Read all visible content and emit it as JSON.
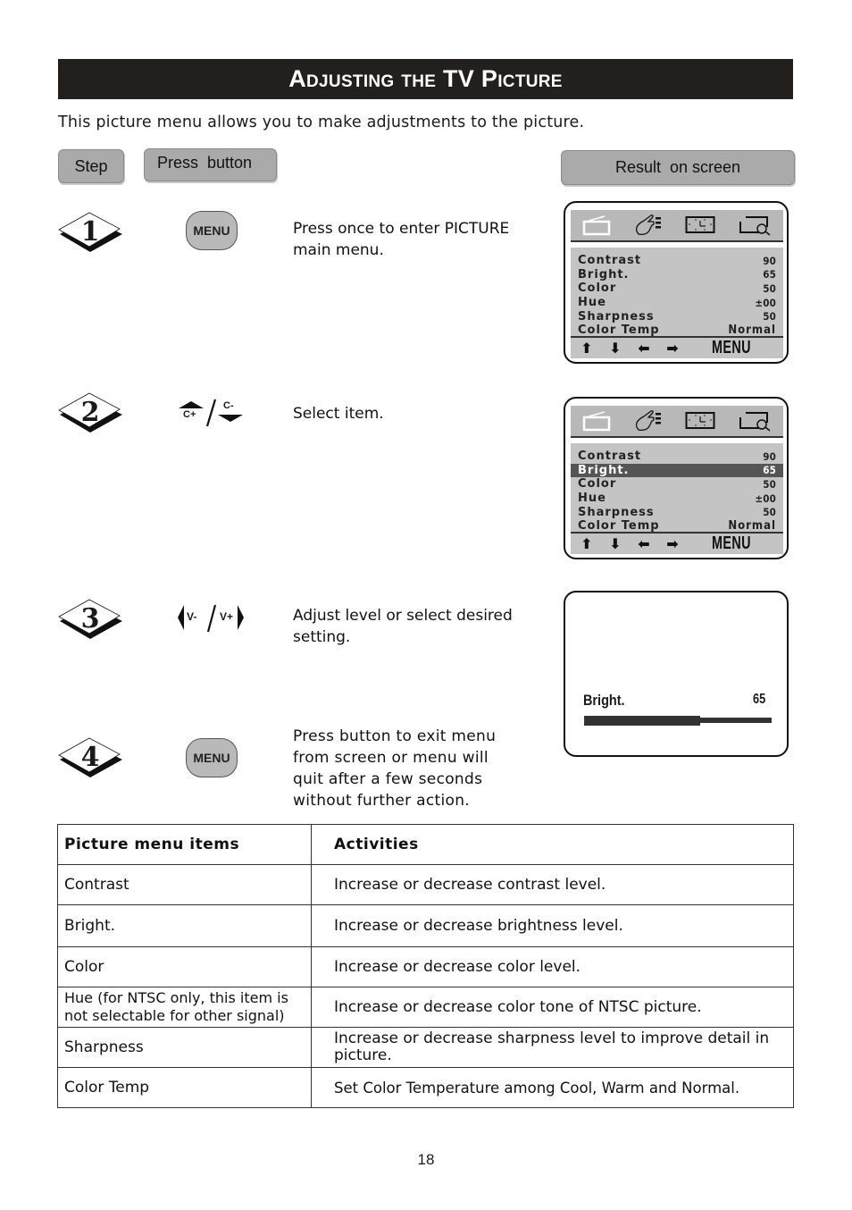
{
  "page": {
    "title": "Adjusting the TV Picture",
    "intro": "This picture menu allows you to make adjustments to the picture.",
    "page_number": "18"
  },
  "headers": {
    "step": "Step",
    "press_button": "Press  button",
    "result_on_screen": "Result  on screen"
  },
  "steps": [
    {
      "number": "1",
      "button": {
        "type": "menu",
        "label": "MENU"
      },
      "description": "Press once to enter PICTURE main menu."
    },
    {
      "number": "2",
      "button": {
        "type": "channel",
        "up_label": "C+",
        "down_label": "C-",
        "separator": "/"
      },
      "description": "Select item."
    },
    {
      "number": "3",
      "button": {
        "type": "volume",
        "left_label": "V-",
        "right_label": "V+",
        "separator": "/"
      },
      "description": "Adjust level or select desired setting."
    },
    {
      "number": "4",
      "button": {
        "type": "menu",
        "label": "MENU"
      },
      "description": "Press button to exit menu from screen or menu will quit after a few seconds without further action."
    }
  ],
  "osd": {
    "tab_icons": [
      "tv-icon",
      "hand-settings-icon",
      "clock-icon",
      "search-screen-icon"
    ],
    "items": [
      {
        "label": "Contrast",
        "value": "90"
      },
      {
        "label": "Bright.",
        "value": "65"
      },
      {
        "label": "Color",
        "value": "50"
      },
      {
        "label": "Hue",
        "value": "±00"
      },
      {
        "label": "Sharpness",
        "value": "50"
      },
      {
        "label": "Color Temp",
        "value": "Normal"
      }
    ],
    "nav_icons": [
      "arrow-up-icon",
      "arrow-down-icon",
      "arrow-left-icon",
      "arrow-right-icon"
    ],
    "menu_label": "MENU",
    "screen2_selected_index": 1
  },
  "adjust_screen": {
    "label": "Bright.",
    "value": "65",
    "level_fraction": 0.62
  },
  "table": {
    "headers": [
      "Picture menu items",
      "Activities"
    ],
    "rows": [
      [
        "Contrast",
        "Increase or decrease contrast level."
      ],
      [
        "Bright.",
        "Increase or decrease brightness level."
      ],
      [
        "Color",
        "Increase or decrease color level."
      ],
      [
        "Hue (for NTSC only, this item is not selectable for other signal)",
        "Increase or decrease color tone of NTSC picture."
      ],
      [
        "Sharpness",
        "Increase or decrease sharpness level to improve detail in picture."
      ],
      [
        "Color Temp",
        "Set Color Temperature among Cool, Warm and Normal."
      ]
    ]
  }
}
